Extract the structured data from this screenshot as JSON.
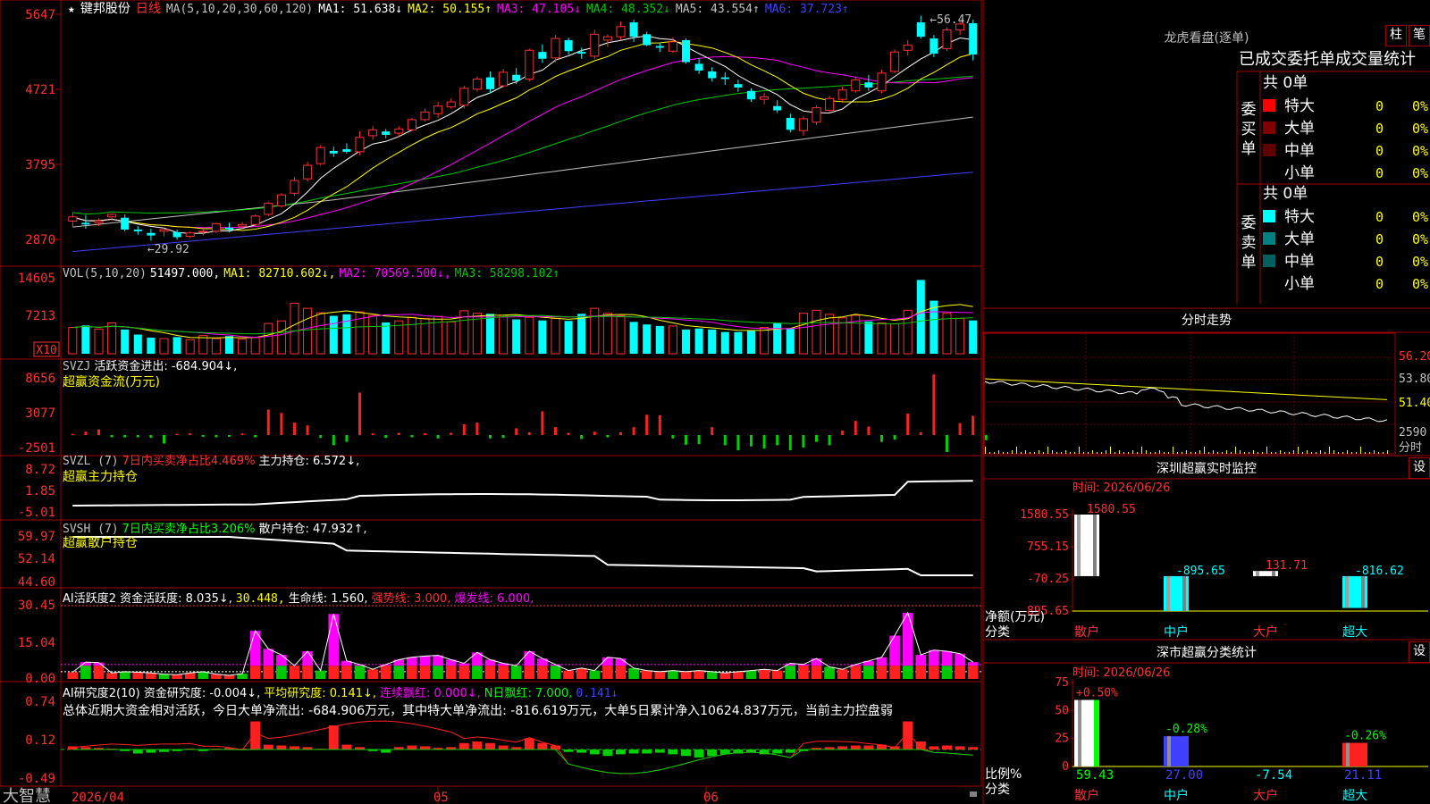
{
  "colors": {
    "up": "#ff3030",
    "down": "#00ffff",
    "ma1": "#ffffff",
    "ma2": "#ffff00",
    "ma3": "#ff00ff",
    "ma4": "#00c800",
    "ma5": "#c0c0c0",
    "ma6": "#4040ff",
    "grid": "#a00000"
  },
  "stock": {
    "star": "★",
    "name": "键邦股份",
    "period": "日线",
    "ma_label": "MA(5,10,20,30,60,120)"
  },
  "ma_values": [
    {
      "label": "MA1: 51.638",
      "arrow": "↓"
    },
    {
      "label": "MA2: 50.155",
      "arrow": "↑"
    },
    {
      "label": "MA3: 47.105",
      "arrow": "↓"
    },
    {
      "label": "MA4: 48.352",
      "arrow": "↓"
    },
    {
      "label": "MA5: 43.554",
      "arrow": "↑"
    },
    {
      "label": "MA6: 37.723",
      "arrow": "↑"
    }
  ],
  "price_axis": [
    "5647",
    "4721",
    "3795",
    "2870"
  ],
  "high_label": "56.47",
  "low_label": "29.92",
  "vol": {
    "header": "VOL(5,10,20)",
    "value": "51497.000",
    "ma1": "MA1: 82710.602",
    "ma1_arrow": "↓",
    "ma2": "MA2: 70569.500",
    "ma2_arrow": "↓",
    "ma3": "MA3: 58298.102",
    "ma3_arrow": "↑",
    "axis": [
      "14605",
      "7213"
    ],
    "unit": "X10"
  },
  "svzj": {
    "title": "SVZJ",
    "desc": "活跃资金进出: -684.904",
    "arrow": "↓",
    "sub": "超赢资金流(万元)",
    "axis": [
      "8656",
      "3077",
      "-2501"
    ]
  },
  "svzl": {
    "title": "SVZL (7)",
    "desc": "7日内买卖净占比4.469%",
    "desc2": "主力持仓: 6.572",
    "arrow": "↓",
    "sub": "超赢主力持仓",
    "axis": [
      "8.72",
      "1.85",
      "-5.01"
    ]
  },
  "svsh": {
    "title": "SVSH (7)",
    "desc": "7日内买卖净占比3.206%",
    "desc2": "散户持仓: 47.932",
    "arrow": "↑",
    "sub": "超赢散户持仓",
    "axis": [
      "59.97",
      "52.14",
      "44.60"
    ]
  },
  "ai1": {
    "title": "AI活跃度2 资金活跃度: 8.035",
    "arrow1": "↓",
    "v2": "30.448,",
    "v3": "生命线: 1.560,",
    "v4": "强势线: 3.000,",
    "v5": "爆发线: 6.000,",
    "axis": [
      "30.45",
      "15.04",
      "0.00"
    ]
  },
  "ai2": {
    "title": "AI研究度2(10) 资金研究度: -0.004",
    "arrow1": "↓",
    "v2": "平均研究度: 0.141",
    "arrow2": "↓",
    "v3": "连续飘红: 0.000",
    "arrow3": "↓",
    "v4": "N日飘红: 7.000,",
    "v5": "0.141",
    "arrow5": "↓",
    "summary": "总体近期大资金相对活跃，今日大单净流出: -684.906万元，其中特大单净流出: -816.619万元，大单5日累计净入10624.837万元，当前主力控盘弱",
    "axis": [
      "0.74",
      "0.12",
      "-0.49"
    ]
  },
  "dates": {
    "d1": "2026/04",
    "d2": "05",
    "d3": "06"
  },
  "brand": "大智慧",
  "right_top": {
    "title": "龙虎看盘(逐单)",
    "btn1": "柱",
    "btn2": "笔",
    "stats_title": "已成交委托单成交量统计",
    "buy_label": "委买单",
    "sell_label": "委卖单",
    "buy_total": "共 0单",
    "sell_total": "共 0单",
    "buy_rows": [
      {
        "name": "特大",
        "num": "0",
        "pct": "0%",
        "color": "#ff0000"
      },
      {
        "name": "大单",
        "num": "0",
        "pct": "0%",
        "color": "#800000"
      },
      {
        "name": "中单",
        "num": "0",
        "pct": "0%",
        "color": "#600000"
      },
      {
        "name": "小单",
        "num": "0",
        "pct": "0%",
        "color": ""
      }
    ],
    "sell_rows": [
      {
        "name": "特大",
        "num": "0",
        "pct": "0%",
        "color": "#00ffff"
      },
      {
        "name": "大单",
        "num": "0",
        "pct": "0%",
        "color": "#008080"
      },
      {
        "name": "中单",
        "num": "0",
        "pct": "0%",
        "color": "#006060"
      },
      {
        "name": "小单",
        "num": "0",
        "pct": "0%",
        "color": ""
      }
    ]
  },
  "intraday": {
    "title": "分时走势",
    "axis": [
      "56.20",
      "53.80",
      "51.40",
      "2590"
    ],
    "unit": "分时"
  },
  "sz_monitor": {
    "title": "深圳超赢实时监控",
    "btn": "设",
    "date": "时间: 2026/06/26",
    "axis": [
      "1580.55",
      "755.15",
      "-70.25",
      "-895.65"
    ],
    "ylabel": "净额(万元)",
    "xlabel": "分类",
    "bars": [
      {
        "name": "散户",
        "value": 1580.55,
        "label": "1580.55",
        "color": "#ffffff"
      },
      {
        "name": "中户",
        "value": -895.65,
        "label": "-895.65",
        "color": "#00ffff"
      },
      {
        "name": "大户",
        "value": 131.71,
        "label": "131.71",
        "color": "#ffffff"
      },
      {
        "name": "超大",
        "value": -816.62,
        "label": "-816.62",
        "color": "#00ffff"
      }
    ]
  },
  "sz_class": {
    "title": "深市超赢分类统计",
    "btn": "设",
    "date": "时间: 2026/06/26",
    "axis": [
      "75",
      "50",
      "25",
      "0"
    ],
    "ylabel": "比例%",
    "xlabel": "分类",
    "bars": [
      {
        "name": "散户",
        "value": 59.43,
        "label": "59.43",
        "change": "+0.50%",
        "color": "#ffffff",
        "side": "#00ff00"
      },
      {
        "name": "中户",
        "value": 27.0,
        "label": "27.00",
        "change": "-0.28%",
        "color": "#4040ff",
        "side": "#4040ff"
      },
      {
        "name": "大户",
        "value": -7.54,
        "label": "-7.54",
        "change": "",
        "color": "#ffffff",
        "side": "#ffffff"
      },
      {
        "name": "超大",
        "value": 21.11,
        "label": "21.11",
        "change": "-0.26%",
        "color": "#ff2020",
        "side": "#ff2020"
      }
    ]
  },
  "candles": [
    [
      32.2,
      33.2,
      31.5,
      32.7
    ],
    [
      32.0,
      32.9,
      31.3,
      31.8
    ],
    [
      32.0,
      32.5,
      31.6,
      32.2
    ],
    [
      32.7,
      33.1,
      32.2,
      33.0
    ],
    [
      32.6,
      33.0,
      31.0,
      31.2
    ],
    [
      31.2,
      31.6,
      30.6,
      31.0
    ],
    [
      30.8,
      31.3,
      29.9,
      30.5
    ],
    [
      31.0,
      31.4,
      30.4,
      31.2
    ],
    [
      30.9,
      31.2,
      30.0,
      30.3
    ],
    [
      30.4,
      31.0,
      30.2,
      30.8
    ],
    [
      30.9,
      31.3,
      30.5,
      31.0
    ],
    [
      31.0,
      32.0,
      30.8,
      31.9
    ],
    [
      31.4,
      32.0,
      30.9,
      31.2
    ],
    [
      31.6,
      32.1,
      31.2,
      31.8
    ],
    [
      31.8,
      33.0,
      31.6,
      32.8
    ],
    [
      33.0,
      34.5,
      32.8,
      34.3
    ],
    [
      34.0,
      35.5,
      33.8,
      35.3
    ],
    [
      35.5,
      37.4,
      35.2,
      37.0
    ],
    [
      37.2,
      39.2,
      36.9,
      38.8
    ],
    [
      39.0,
      41.2,
      38.8,
      40.9
    ],
    [
      40.5,
      41.0,
      39.8,
      40.2
    ],
    [
      40.7,
      41.4,
      40.2,
      40.4
    ],
    [
      40.4,
      42.8,
      40.0,
      42.1
    ],
    [
      42.3,
      43.4,
      41.8,
      43.0
    ],
    [
      42.8,
      43.1,
      42.0,
      42.4
    ],
    [
      42.6,
      43.4,
      42.2,
      43.1
    ],
    [
      43.0,
      44.4,
      42.8,
      44.2
    ],
    [
      44.2,
      45.5,
      44.0,
      45.1
    ],
    [
      44.9,
      46.3,
      44.4,
      45.8
    ],
    [
      45.7,
      46.7,
      45.5,
      46.3
    ],
    [
      45.9,
      48.2,
      45.5,
      47.9
    ],
    [
      47.8,
      49.3,
      47.5,
      49.0
    ],
    [
      49.2,
      49.9,
      47.3,
      47.8
    ],
    [
      48.2,
      50.2,
      48.0,
      49.8
    ],
    [
      49.5,
      50.3,
      48.4,
      48.8
    ],
    [
      49.0,
      52.6,
      48.7,
      52.4
    ],
    [
      52.2,
      53.1,
      50.9,
      51.4
    ],
    [
      51.5,
      54.2,
      51.0,
      53.8
    ],
    [
      53.6,
      53.9,
      51.9,
      52.3
    ],
    [
      52.2,
      52.7,
      51.4,
      52.0
    ],
    [
      51.7,
      54.8,
      51.4,
      54.3
    ],
    [
      53.6,
      54.3,
      52.8,
      54.0
    ],
    [
      54.0,
      55.8,
      53.6,
      55.2
    ],
    [
      55.7,
      56.0,
      53.4,
      54.0
    ],
    [
      54.3,
      54.6,
      52.9,
      53.0
    ],
    [
      52.9,
      53.3,
      52.2,
      52.7
    ],
    [
      52.3,
      53.9,
      52.1,
      53.4
    ],
    [
      53.6,
      53.8,
      50.8,
      51.0
    ],
    [
      50.8,
      51.5,
      49.6,
      50.0
    ],
    [
      49.9,
      50.4,
      48.7,
      49.1
    ],
    [
      49.2,
      49.8,
      48.3,
      49.0
    ],
    [
      48.4,
      48.9,
      47.5,
      48.0
    ],
    [
      47.6,
      47.9,
      46.3,
      46.6
    ],
    [
      46.6,
      47.4,
      46.0,
      46.9
    ],
    [
      45.8,
      46.5,
      45.0,
      45.3
    ],
    [
      44.4,
      44.9,
      42.7,
      43.0
    ],
    [
      42.9,
      44.6,
      42.3,
      44.3
    ],
    [
      43.9,
      45.9,
      43.6,
      45.6
    ],
    [
      45.3,
      47.0,
      45.0,
      46.7
    ],
    [
      46.6,
      48.1,
      46.2,
      47.7
    ],
    [
      47.6,
      49.3,
      47.4,
      48.9
    ],
    [
      48.6,
      49.5,
      47.6,
      48.0
    ],
    [
      47.6,
      50.1,
      47.3,
      49.7
    ],
    [
      49.9,
      52.5,
      49.7,
      52.2
    ],
    [
      52.4,
      53.6,
      51.8,
      53.0
    ],
    [
      55.7,
      56.47,
      53.8,
      54.0
    ],
    [
      53.8,
      54.2,
      51.6,
      52.0
    ],
    [
      52.6,
      55.1,
      52.3,
      54.8
    ],
    [
      54.8,
      55.9,
      54.2,
      55.5
    ],
    [
      55.6,
      56.0,
      51.2,
      51.9
    ]
  ],
  "vol_bars": [
    5.2,
    5.6,
    4.9,
    6.1,
    4.8,
    3.8,
    3.2,
    3.0,
    3.3,
    2.8,
    3.6,
    3.0,
    3.5,
    2.9,
    3.2,
    6.0,
    6.5,
    10.0,
    9.0,
    8.1,
    7.5,
    7.8,
    8.3,
    7.6,
    6.2,
    6.5,
    7.2,
    7.0,
    7.4,
    6.3,
    8.5,
    8.0,
    7.9,
    7.6,
    6.8,
    7.2,
    6.6,
    7.0,
    6.5,
    7.9,
    9.0,
    8.0,
    7.5,
    6.3,
    5.8,
    5.5,
    5.5,
    4.8,
    5.0,
    4.8,
    4.3,
    4.3,
    4.6,
    5.2,
    6.0,
    5.0,
    8.0,
    8.6,
    7.8,
    7.1,
    7.6,
    6.4,
    6.1,
    5.9,
    8.6,
    14.6,
    10.5,
    8.0,
    7.0,
    6.6
  ],
  "flow_bars": [
    0.2,
    0.6,
    1.0,
    -0.4,
    -0.4,
    -0.4,
    -0.5,
    -1.5,
    0.2,
    0.3,
    -0.3,
    -0.4,
    -0.3,
    0.3,
    -0.4,
    4.5,
    3.9,
    2.2,
    1.7,
    -0.5,
    -1.8,
    -1.2,
    7.5,
    0.3,
    -0.5,
    0.4,
    -0.4,
    0.3,
    -0.6,
    0.4,
    1.9,
    2.2,
    -0.6,
    -0.5,
    1.2,
    0.5,
    4.2,
    1.4,
    0.4,
    -0.7,
    0.6,
    -0.4,
    0.5,
    1.4,
    3.6,
    3.5,
    -0.6,
    -1.7,
    -1.6,
    1.4,
    -1.8,
    -2.7,
    -2.0,
    -2.4,
    -1.8,
    -2.7,
    -2.2,
    -1.2,
    -1.8,
    0.8,
    2.5,
    1.5,
    -1.2,
    -0.8,
    3.8,
    0.5,
    10.7,
    -3.0,
    2.1,
    3.4,
    -0.9
  ],
  "ai1_bars": [
    2.8,
    7.0,
    6.8,
    2.5,
    3.0,
    2.8,
    2.5,
    2.0,
    1.8,
    2.5,
    3.0,
    2.0,
    1.5,
    2.2,
    20.0,
    12.5,
    10.0,
    5.5,
    11.5,
    3.5,
    27.0,
    7.5,
    6.0,
    4.0,
    6.0,
    8.0,
    9.0,
    9.5,
    9.8,
    8.0,
    6.5,
    11.0,
    8.0,
    6.5,
    5.5,
    11.5,
    8.5,
    6.0,
    3.5,
    4.5,
    3.5,
    9.0,
    8.5,
    4.5,
    3.5,
    3.0,
    3.5,
    3.0,
    3.5,
    3.0,
    2.5,
    3.0,
    3.5,
    4.0,
    3.5,
    6.5,
    6.0,
    8.5,
    5.0,
    4.0,
    6.0,
    7.5,
    9.0,
    18.0,
    27.5,
    10.0,
    12.0,
    11.5,
    10.5,
    7.0
  ],
  "ai2_bars": [
    0.04,
    0.03,
    0.02,
    0.01,
    -0.02,
    -0.05,
    -0.04,
    -0.03,
    -0.02,
    0.01,
    -0.02,
    0.01,
    0.02,
    0.01,
    0.35,
    0.06,
    0.05,
    0.04,
    0.03,
    0.01,
    0.3,
    0.06,
    0.03,
    -0.02,
    -0.04,
    0.03,
    0.05,
    0.04,
    0.02,
    0.03,
    0.08,
    0.1,
    0.08,
    0.05,
    0.03,
    0.14,
    0.08,
    0.05,
    -0.03,
    -0.04,
    -0.06,
    -0.08,
    -0.06,
    -0.05,
    -0.05,
    -0.04,
    -0.06,
    -0.08,
    -0.1,
    -0.08,
    -0.06,
    -0.05,
    -0.04,
    -0.06,
    -0.05,
    -0.04,
    -0.02,
    0.02,
    0.03,
    0.04,
    0.05,
    0.05,
    0.06,
    0.04,
    0.35,
    0.1,
    0.04,
    0.05,
    0.04,
    0.03
  ]
}
